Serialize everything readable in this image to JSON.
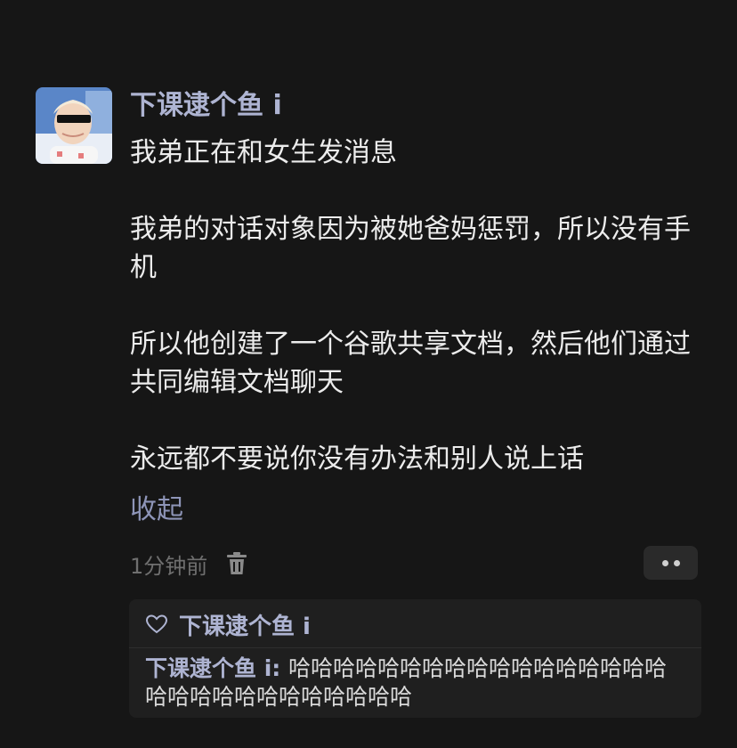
{
  "post": {
    "author": "下课逮个鱼 i",
    "paragraphs": [
      "我弟正在和女生发消息",
      "我弟的对话对象因为被她爸妈惩罚，所以没有手机",
      "所以他创建了一个谷歌共享文档，然后他们通过共同编辑文档聊天",
      "永远都不要说你没有办法和别人说上话"
    ],
    "collapse_label": "收起",
    "timestamp": "1分钟前"
  },
  "icons": {
    "avatar": "avatar-photo",
    "delete": "trash-icon",
    "more": "more-dots-icon",
    "like": "heart-icon"
  },
  "likes": {
    "names": "下课逮个鱼 i"
  },
  "reply": {
    "author": "下课逮个鱼 i",
    "separator": ": ",
    "text": "哈哈哈哈哈哈哈哈哈哈哈哈哈哈哈哈哈哈哈哈哈哈哈哈哈哈哈哈哈"
  },
  "colors": {
    "background": "#161616",
    "name_accent": "#aeb4d2",
    "link_accent": "#8e95b8",
    "reply_box": "#1f1f1f"
  }
}
